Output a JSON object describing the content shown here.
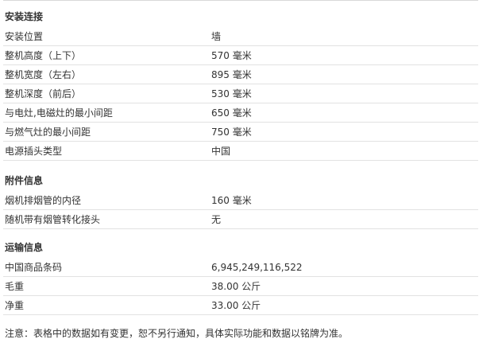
{
  "sections": [
    {
      "title": "安装连接",
      "rows": [
        {
          "label": "安装位置",
          "value": "墙"
        },
        {
          "label": "整机高度（上下）",
          "value": "570 毫米"
        },
        {
          "label": "整机宽度（左右）",
          "value": "895 毫米"
        },
        {
          "label": "整机深度（前后）",
          "value": "530 毫米"
        },
        {
          "label": "与电灶,电磁灶的最小间距",
          "value": "650 毫米"
        },
        {
          "label": "与燃气灶的最小间距",
          "value": "750 毫米"
        },
        {
          "label": "电源插头类型",
          "value": "中国"
        }
      ]
    },
    {
      "title": "附件信息",
      "rows": [
        {
          "label": "烟机排烟管的内径",
          "value": "160 毫米"
        },
        {
          "label": "随机带有烟管转化接头",
          "value": "无"
        }
      ]
    },
    {
      "title": "运输信息",
      "rows": [
        {
          "label": "中国商品条码",
          "value": "6,945,249,116,522"
        },
        {
          "label": "毛重",
          "value": "38.00 公斤"
        },
        {
          "label": "净重",
          "value": "33.00 公斤"
        }
      ]
    }
  ],
  "footnote": "注意：表格中的数据如有变更，恕不另行通知，具体实际功能和数据以铭牌为准。"
}
